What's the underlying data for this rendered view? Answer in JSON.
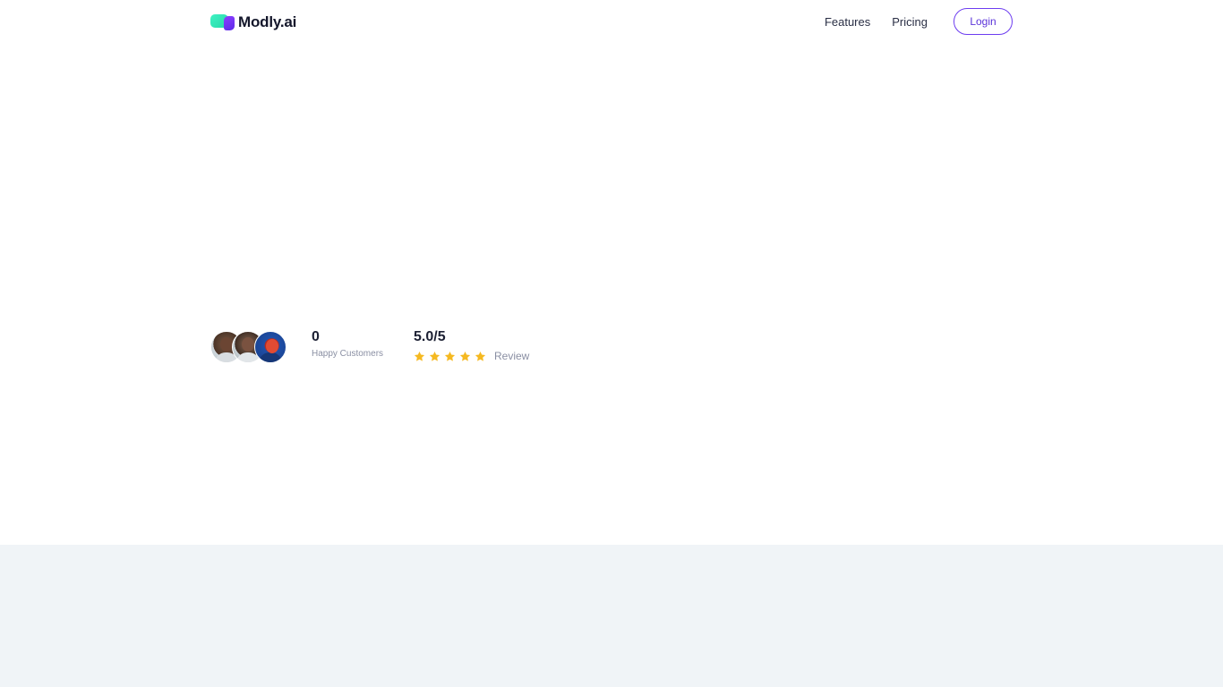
{
  "brand": {
    "name": "Modly.ai",
    "accent_color": "#6d3df0",
    "logo_colors": [
      "#3df2c2",
      "#8b3dff"
    ]
  },
  "nav": {
    "items": [
      {
        "label": "Features"
      },
      {
        "label": "Pricing"
      }
    ],
    "login_label": "Login"
  },
  "social_proof": {
    "avatars": [
      {
        "icon": "person-avatar"
      },
      {
        "icon": "person-avatar"
      },
      {
        "icon": "illustrated-avatar"
      }
    ],
    "customers": {
      "value": "0",
      "label": "Happy Customers"
    },
    "rating": {
      "value": "5.0/5",
      "stars": 5,
      "max_stars": 5,
      "star_color": "#f5b921",
      "label": "Review"
    }
  },
  "colors": {
    "lower_band": "#f0f4f7"
  }
}
